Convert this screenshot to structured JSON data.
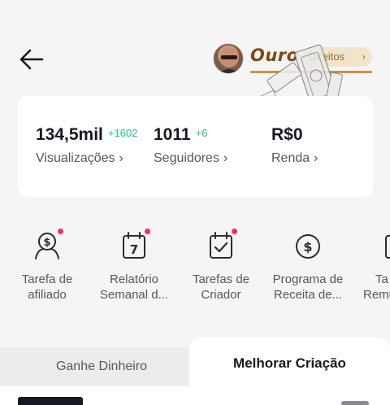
{
  "header": {
    "back_icon": "arrow-left-icon",
    "tier": "Ouro",
    "benefits": "Direitos",
    "benefits_chevron": "›"
  },
  "stats": [
    {
      "value": "134,5mil",
      "delta": "+1602",
      "label": "Visualizações",
      "chevron": "›"
    },
    {
      "value": "1011",
      "delta": "+6",
      "label": "Seguidores",
      "chevron": "›"
    },
    {
      "value": "R$0",
      "delta": "",
      "label": "Renda",
      "chevron": "›"
    }
  ],
  "tools": [
    {
      "line1": "Tarefa de",
      "line2": "afiliado",
      "icon": "affiliate-dollar-icon",
      "dot": true
    },
    {
      "line1": "Relatório",
      "line2": "Semanal d...",
      "icon": "calendar-7-icon",
      "dot": true
    },
    {
      "line1": "Tarefas de",
      "line2": "Criador",
      "icon": "calendar-check-icon",
      "dot": true
    },
    {
      "line1": "Programa de",
      "line2": "Receita de...",
      "icon": "dollar-circle-icon",
      "dot": false
    },
    {
      "line1": "Ta",
      "line2": "Remu",
      "icon": "partial-icon",
      "dot": false
    }
  ],
  "tabs": {
    "left": "Ganhe Dinheiro",
    "right": "Melhorar Criação",
    "active": "right"
  },
  "colors": {
    "accent_green": "#24c289",
    "notification_red": "#fe2c55",
    "tier_gold": "#c99540"
  }
}
